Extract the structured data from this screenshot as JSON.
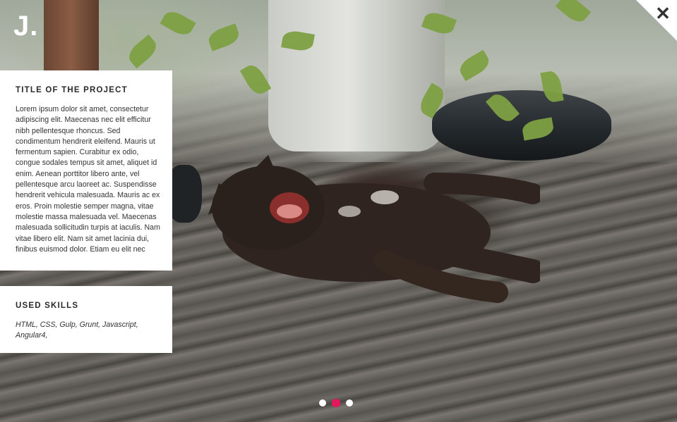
{
  "logo": {
    "text": "J."
  },
  "close": {
    "icon": "close-icon",
    "glyph": "✕"
  },
  "project": {
    "title": "TITLE OF THE PROJECT",
    "description": "Lorem ipsum dolor sit amet, consectetur adipiscing elit. Maecenas nec elit efficitur nibh pellentesque rhoncus. Sed condimentum hendrerit eleifend. Mauris ut fermentum sapien. Curabitur ex odio, congue sodales tempus sit amet, aliquet id enim. Aenean porttitor libero ante, vel pellentesque arcu laoreet ac. Suspendisse hendrerit vehicula malesuada. Mauris ac ex eros. Proin molestie semper magna, vitae molestie massa malesuada vel. Maecenas malesuada sollicitudin turpis at iaculis. Nam vitae libero elit. Nam sit amet lacinia dui, finibus euismod dolor. Etiam eu elit nec"
  },
  "skills": {
    "title": "USED SKILLS",
    "list": "HTML, CSS, Gulp, Grunt, Javascript, Angular4,"
  },
  "slider": {
    "total": 3,
    "active_index": 1,
    "active_color": "#e8145c",
    "inactive_color": "#ffffff"
  }
}
